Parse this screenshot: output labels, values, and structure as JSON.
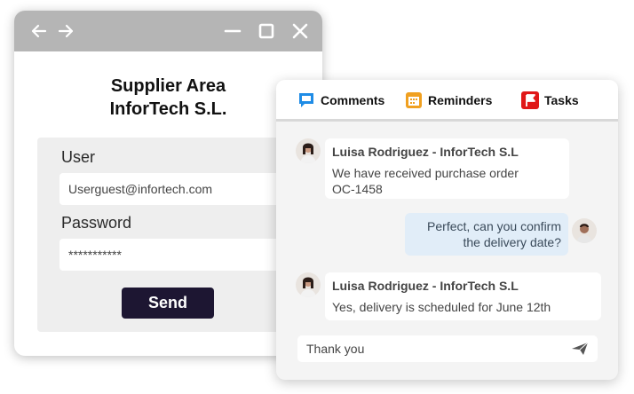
{
  "login": {
    "title_line1": "Supplier Area",
    "title_line2": "InforTech S.L.",
    "user_label": "User",
    "user_value": "Userguest@infortech.com",
    "password_label": "Password",
    "password_value": "***********",
    "send_label": "Send",
    "icons": [
      "arrow-left-icon",
      "arrow-right-icon",
      "minimize-icon",
      "maximize-icon",
      "close-icon"
    ]
  },
  "chat": {
    "tabs": [
      {
        "label": "Comments",
        "icon": "comment-icon",
        "color": "#1f8ce6"
      },
      {
        "label": "Reminders",
        "icon": "calendar-icon",
        "color": "#f0a020"
      },
      {
        "label": "Tasks",
        "icon": "flag-icon",
        "color": "#e01818"
      }
    ],
    "messages": [
      {
        "sender": "Luisa Rodriguez - InforTech S.L",
        "text_line1": "We have received purchase order",
        "text_line2": "OC-1458"
      },
      {
        "text_line1": "Perfect, can you confirm",
        "text_line2": "the delivery date?"
      },
      {
        "sender": "Luisa Rodriguez - InforTech S.L",
        "text_line1": "Yes, delivery is scheduled for June 12th"
      }
    ],
    "composer_value": "Thank you"
  }
}
